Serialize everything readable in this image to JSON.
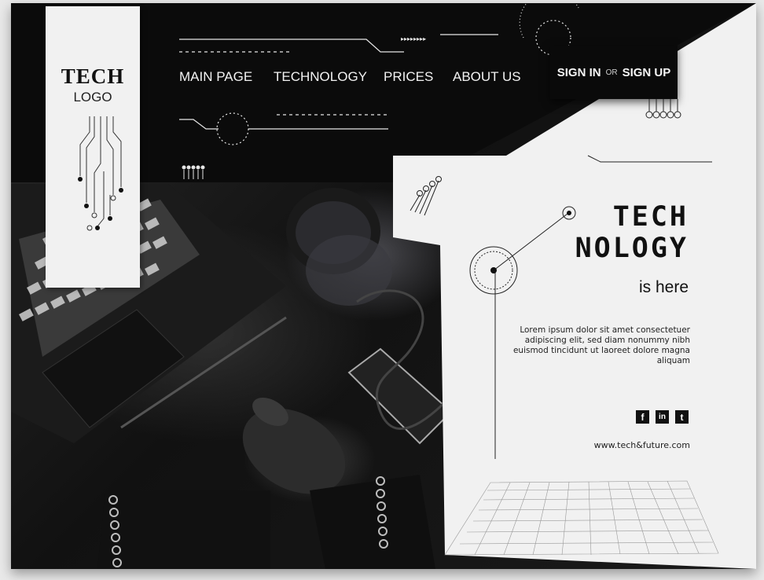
{
  "logo": {
    "title": "TECH",
    "subtitle": "LOGO"
  },
  "nav": {
    "items": [
      "MAIN PAGE",
      "TECHNOLOGY",
      "PRICES",
      "ABOUT US"
    ]
  },
  "auth": {
    "sign_in": "SIGN IN",
    "or": "OR",
    "sign_up": "SIGN UP"
  },
  "hero": {
    "title_line1": "TECH",
    "title_line2": "NOLOGY",
    "subtitle": "is here",
    "body": "Lorem ipsum dolor sit amet consectetuer adipiscing elit, sed diam nonummy nibh euismod tincidunt ut laoreet dolore magna aliquam"
  },
  "social": {
    "icons": [
      "facebook-icon",
      "linkedin-icon",
      "twitter-icon"
    ],
    "facebook": "f",
    "linkedin": "in",
    "twitter": "t"
  },
  "footer": {
    "url": "www.tech&future.com"
  },
  "colors": {
    "dark": "#0b0b0b",
    "panel": "#f1f1f1",
    "text_light": "#f2f2f2"
  }
}
